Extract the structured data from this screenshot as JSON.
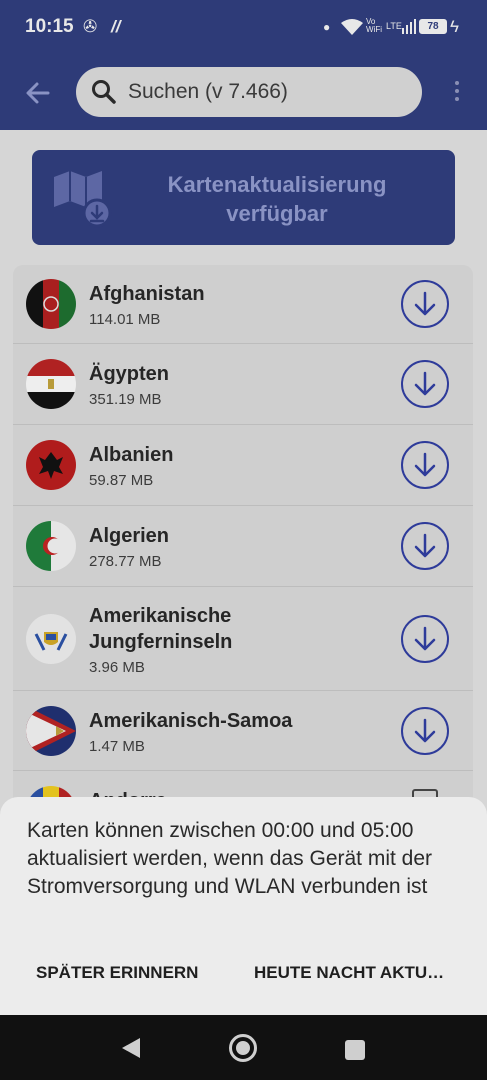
{
  "status_bar": {
    "time": "10:15",
    "battery": "78",
    "network": "LTE",
    "vowifi": "Vo WiFi"
  },
  "app_bar": {
    "search_placeholder": "Suchen (v 7.466)"
  },
  "banner": {
    "text": "Kartenaktualisierung verfügbar"
  },
  "countries": [
    {
      "name": "Afghanistan",
      "size": "114.01 MB"
    },
    {
      "name": "Ägypten",
      "size": "351.19 MB"
    },
    {
      "name": "Albanien",
      "size": "59.87 MB"
    },
    {
      "name": "Algerien",
      "size": "278.77 MB"
    },
    {
      "name": "Amerikanische Jungferninseln",
      "size": "3.96 MB"
    },
    {
      "name": "Amerikanisch-Samoa",
      "size": "1.47 MB"
    },
    {
      "name": "Andorra",
      "size": ""
    }
  ],
  "sheet": {
    "message": "Karten können zwischen 00:00 und 05:00 aktualisiert werden, wenn das Gerät mit der Stromversorgung und WLAN verbunden ist",
    "later_label": "SPÄTER ERINNERN",
    "tonight_label": "HEUTE NACHT AKTU…"
  },
  "colors": {
    "app_bar": "#2e3b78",
    "accent": "#2e3b9a",
    "sheet": "#ececec"
  }
}
